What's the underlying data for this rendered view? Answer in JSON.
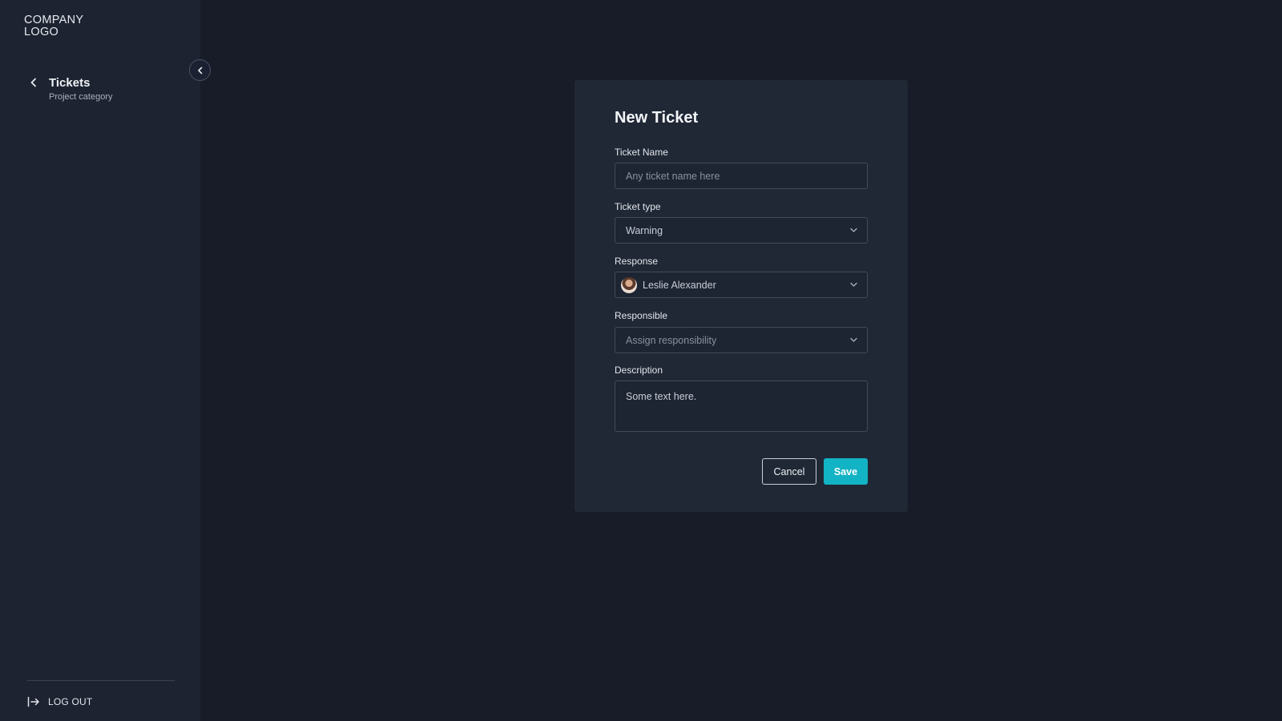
{
  "sidebar": {
    "logo_line1": "COMPANY",
    "logo_line2": "LOGO",
    "nav": {
      "title": "Tickets",
      "subtitle": "Project category"
    },
    "logout_label": "LOG OUT"
  },
  "form": {
    "title": "New Ticket",
    "ticket_name": {
      "label": "Ticket Name",
      "placeholder": "Any ticket name here"
    },
    "ticket_type": {
      "label": "Ticket type",
      "value": "Warning"
    },
    "response": {
      "label": "Response",
      "value": "Leslie Alexander"
    },
    "responsible": {
      "label": "Responsible",
      "placeholder": "Assign responsibility"
    },
    "description": {
      "label": "Description",
      "value": "Some text here."
    },
    "cancel_label": "Cancel",
    "save_label": "Save"
  },
  "colors": {
    "background": "#171c28",
    "sidebar": "#1d2331",
    "card": "#202836",
    "accent": "#12b3c4"
  },
  "icons": [
    "collapse-chevron-left-icon",
    "back-chevron-left-icon",
    "chevron-down-icon",
    "logout-icon"
  ]
}
